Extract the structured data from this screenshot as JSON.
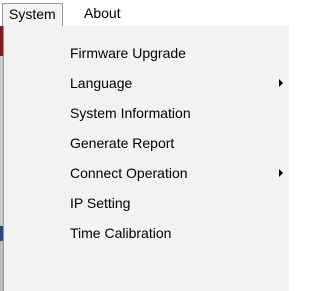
{
  "menubar": {
    "items": [
      {
        "label": "System",
        "active": true
      },
      {
        "label": "About",
        "active": false
      }
    ]
  },
  "dropdown": {
    "items": [
      {
        "label": "Firmware Upgrade",
        "submenu": false
      },
      {
        "label": "Language",
        "submenu": true
      },
      {
        "label": "System Information",
        "submenu": false
      },
      {
        "label": "Generate Report",
        "submenu": false
      },
      {
        "label": "Connect Operation",
        "submenu": true
      },
      {
        "label": "IP Setting",
        "submenu": false
      },
      {
        "label": "Time Calibration",
        "submenu": false
      }
    ]
  },
  "colors": {
    "menu_background": "#f2f2f2",
    "border": "#9a9a9a",
    "text": "#000000"
  }
}
